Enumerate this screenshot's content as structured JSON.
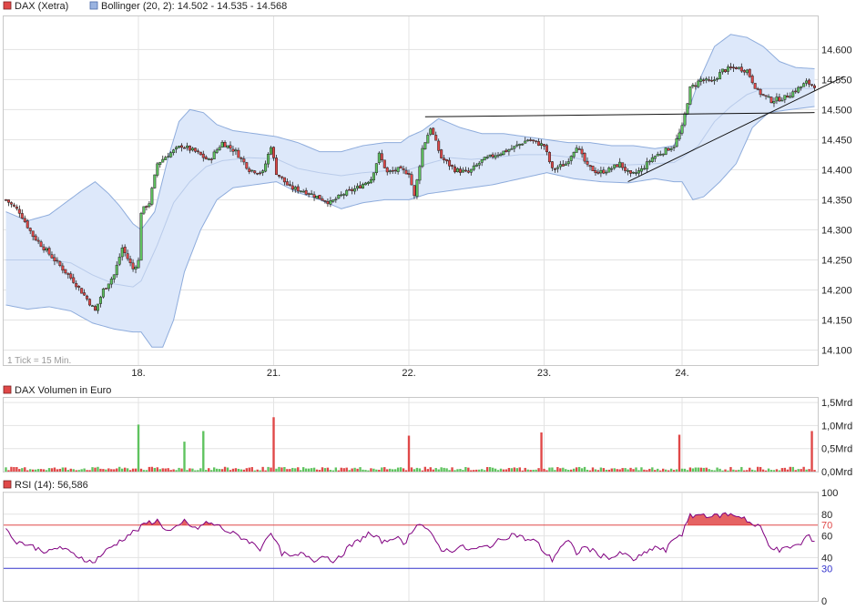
{
  "colors": {
    "up": "#5fc35f",
    "down": "#e04848",
    "band_fill": "#dde8fa",
    "band_line": "#8eacdc",
    "rsi_line": "#800080",
    "rsi_hi": "#e04848",
    "rsi_lo": "#3333cc"
  },
  "chart_data": [
    {
      "type": "candlestick",
      "legend": [
        {
          "label": "DAX (Xetra)",
          "color": "#e04848",
          "icon": "red-square-icon"
        },
        {
          "label": "Bollinger (20, 2): 14.502 - 14.535 - 14.568",
          "color": "#9ab3e0",
          "icon": "blue-square-icon"
        }
      ],
      "note": "1 Tick = 15 Min.",
      "ylim": [
        14075,
        14655
      ],
      "y_ticks": [
        "14.100",
        "14.150",
        "14.200",
        "14.250",
        "14.300",
        "14.350",
        "14.400",
        "14.450",
        "14.500",
        "14.550",
        "14.600"
      ],
      "y_tick_values": [
        14100,
        14150,
        14200,
        14250,
        14300,
        14350,
        14400,
        14450,
        14500,
        14550,
        14600
      ],
      "x_ticks": [
        "18.",
        "21.",
        "22.",
        "23.",
        "24."
      ],
      "x_tick_index": [
        49,
        99,
        149,
        199,
        250
      ],
      "n_bars": 300,
      "close_anchors": [
        [
          0,
          14350
        ],
        [
          5,
          14330
        ],
        [
          10,
          14290
        ],
        [
          15,
          14265
        ],
        [
          20,
          14240
        ],
        [
          25,
          14215
        ],
        [
          30,
          14185
        ],
        [
          33,
          14165
        ],
        [
          36,
          14200
        ],
        [
          40,
          14225
        ],
        [
          43,
          14270
        ],
        [
          47,
          14235
        ],
        [
          49,
          14248
        ],
        [
          50,
          14330
        ],
        [
          53,
          14345
        ],
        [
          56,
          14410
        ],
        [
          60,
          14425
        ],
        [
          65,
          14440
        ],
        [
          70,
          14430
        ],
        [
          75,
          14415
        ],
        [
          80,
          14445
        ],
        [
          85,
          14430
        ],
        [
          90,
          14400
        ],
        [
          95,
          14395
        ],
        [
          98,
          14440
        ],
        [
          100,
          14395
        ],
        [
          105,
          14370
        ],
        [
          110,
          14365
        ],
        [
          115,
          14355
        ],
        [
          120,
          14345
        ],
        [
          125,
          14360
        ],
        [
          130,
          14370
        ],
        [
          135,
          14385
        ],
        [
          138,
          14425
        ],
        [
          141,
          14395
        ],
        [
          145,
          14400
        ],
        [
          149,
          14395
        ],
        [
          151,
          14355
        ],
        [
          154,
          14435
        ],
        [
          157,
          14470
        ],
        [
          161,
          14420
        ],
        [
          166,
          14400
        ],
        [
          171,
          14395
        ],
        [
          176,
          14415
        ],
        [
          181,
          14425
        ],
        [
          187,
          14435
        ],
        [
          193,
          14450
        ],
        [
          199,
          14440
        ],
        [
          202,
          14400
        ],
        [
          207,
          14410
        ],
        [
          211,
          14440
        ],
        [
          215,
          14405
        ],
        [
          219,
          14395
        ],
        [
          223,
          14400
        ],
        [
          227,
          14410
        ],
        [
          231,
          14390
        ],
        [
          235,
          14400
        ],
        [
          239,
          14420
        ],
        [
          243,
          14430
        ],
        [
          247,
          14440
        ],
        [
          250,
          14470
        ],
        [
          253,
          14535
        ],
        [
          257,
          14550
        ],
        [
          261,
          14545
        ],
        [
          265,
          14565
        ],
        [
          270,
          14570
        ],
        [
          274,
          14565
        ],
        [
          278,
          14530
        ],
        [
          283,
          14515
        ],
        [
          288,
          14520
        ],
        [
          293,
          14535
        ],
        [
          296,
          14545
        ],
        [
          299,
          14540
        ]
      ],
      "bollinger_upper_anchors": [
        [
          0,
          14330
        ],
        [
          8,
          14315
        ],
        [
          16,
          14325
        ],
        [
          22,
          14345
        ],
        [
          28,
          14365
        ],
        [
          33,
          14380
        ],
        [
          38,
          14360
        ],
        [
          42,
          14340
        ],
        [
          47,
          14310
        ],
        [
          50,
          14300
        ],
        [
          55,
          14330
        ],
        [
          60,
          14420
        ],
        [
          64,
          14480
        ],
        [
          68,
          14500
        ],
        [
          73,
          14495
        ],
        [
          78,
          14475
        ],
        [
          84,
          14465
        ],
        [
          92,
          14460
        ],
        [
          100,
          14455
        ],
        [
          108,
          14445
        ],
        [
          116,
          14430
        ],
        [
          124,
          14430
        ],
        [
          132,
          14440
        ],
        [
          140,
          14445
        ],
        [
          146,
          14445
        ],
        [
          149,
          14455
        ],
        [
          154,
          14465
        ],
        [
          160,
          14485
        ],
        [
          168,
          14470
        ],
        [
          176,
          14460
        ],
        [
          184,
          14460
        ],
        [
          192,
          14455
        ],
        [
          200,
          14450
        ],
        [
          208,
          14445
        ],
        [
          216,
          14445
        ],
        [
          224,
          14440
        ],
        [
          232,
          14440
        ],
        [
          240,
          14435
        ],
        [
          247,
          14440
        ],
        [
          250,
          14470
        ],
        [
          256,
          14545
        ],
        [
          262,
          14605
        ],
        [
          268,
          14625
        ],
        [
          274,
          14620
        ],
        [
          280,
          14605
        ],
        [
          286,
          14580
        ],
        [
          292,
          14570
        ],
        [
          299,
          14568
        ]
      ],
      "bollinger_mid_anchors": [
        [
          0,
          14250
        ],
        [
          8,
          14250
        ],
        [
          16,
          14250
        ],
        [
          24,
          14245
        ],
        [
          32,
          14225
        ],
        [
          40,
          14210
        ],
        [
          47,
          14205
        ],
        [
          50,
          14215
        ],
        [
          56,
          14275
        ],
        [
          62,
          14345
        ],
        [
          68,
          14380
        ],
        [
          74,
          14405
        ],
        [
          80,
          14415
        ],
        [
          90,
          14420
        ],
        [
          100,
          14418
        ],
        [
          108,
          14402
        ],
        [
          116,
          14395
        ],
        [
          124,
          14390
        ],
        [
          132,
          14395
        ],
        [
          140,
          14398
        ],
        [
          149,
          14400
        ],
        [
          156,
          14410
        ],
        [
          164,
          14420
        ],
        [
          172,
          14417
        ],
        [
          180,
          14420
        ],
        [
          190,
          14425
        ],
        [
          200,
          14425
        ],
        [
          210,
          14420
        ],
        [
          220,
          14410
        ],
        [
          230,
          14408
        ],
        [
          240,
          14410
        ],
        [
          247,
          14412
        ],
        [
          250,
          14420
        ],
        [
          256,
          14440
        ],
        [
          262,
          14480
        ],
        [
          268,
          14505
        ],
        [
          274,
          14525
        ],
        [
          280,
          14535
        ],
        [
          290,
          14535
        ],
        [
          299,
          14535
        ]
      ],
      "bollinger_lower_anchors": [
        [
          0,
          14175
        ],
        [
          8,
          14168
        ],
        [
          16,
          14172
        ],
        [
          24,
          14165
        ],
        [
          32,
          14145
        ],
        [
          40,
          14135
        ],
        [
          47,
          14130
        ],
        [
          50,
          14130
        ],
        [
          54,
          14105
        ],
        [
          58,
          14105
        ],
        [
          62,
          14150
        ],
        [
          66,
          14230
        ],
        [
          72,
          14300
        ],
        [
          78,
          14350
        ],
        [
          84,
          14370
        ],
        [
          92,
          14375
        ],
        [
          100,
          14380
        ],
        [
          108,
          14362
        ],
        [
          116,
          14350
        ],
        [
          124,
          14335
        ],
        [
          132,
          14345
        ],
        [
          140,
          14350
        ],
        [
          149,
          14350
        ],
        [
          156,
          14360
        ],
        [
          164,
          14365
        ],
        [
          172,
          14370
        ],
        [
          180,
          14375
        ],
        [
          190,
          14385
        ],
        [
          200,
          14395
        ],
        [
          210,
          14385
        ],
        [
          220,
          14380
        ],
        [
          230,
          14378
        ],
        [
          240,
          14385
        ],
        [
          247,
          14380
        ],
        [
          250,
          14380
        ],
        [
          254,
          14350
        ],
        [
          258,
          14355
        ],
        [
          264,
          14380
        ],
        [
          270,
          14410
        ],
        [
          276,
          14470
        ],
        [
          282,
          14495
        ],
        [
          290,
          14500
        ],
        [
          299,
          14505
        ]
      ],
      "trendlines": [
        {
          "from": [
            155,
            14488
          ],
          "to": [
            299,
            14495
          ]
        },
        {
          "from": [
            230,
            14380
          ],
          "to": [
            310,
            14555
          ]
        }
      ]
    },
    {
      "type": "bar",
      "title": "DAX Volumen in Euro",
      "legend_color": "#e04848",
      "ylim": [
        0,
        1.6
      ],
      "y_ticks": [
        "0,0Mrd",
        "0,5Mrd",
        "1,0Mrd",
        "1,5Mrd"
      ],
      "y_tick_values": [
        0,
        0.5,
        1.0,
        1.5
      ],
      "base_volume": 0.08,
      "spikes": [
        {
          "i": 49,
          "v": 1.02,
          "up": true
        },
        {
          "i": 66,
          "v": 0.65,
          "up": true
        },
        {
          "i": 73,
          "v": 0.88,
          "up": true
        },
        {
          "i": 99,
          "v": 1.18,
          "up": false
        },
        {
          "i": 149,
          "v": 0.78,
          "up": false
        },
        {
          "i": 198,
          "v": 0.85,
          "up": false
        },
        {
          "i": 249,
          "v": 0.8,
          "up": false
        },
        {
          "i": 298,
          "v": 0.88,
          "up": false
        }
      ],
      "x_ticks": [
        "18.",
        "21.",
        "22.",
        "23.",
        "24."
      ]
    },
    {
      "type": "line",
      "title": "RSI (14): 56,586",
      "legend_color": "#e04848",
      "ylim": [
        0,
        100
      ],
      "y_ticks": [
        "0",
        "30",
        "40",
        "60",
        "70",
        "80",
        "100"
      ],
      "y_tick_values": [
        0,
        30,
        40,
        60,
        70,
        80,
        100
      ],
      "overbought": 70,
      "oversold": 30,
      "anchors": [
        [
          0,
          65
        ],
        [
          4,
          55
        ],
        [
          8,
          52
        ],
        [
          12,
          48
        ],
        [
          16,
          45
        ],
        [
          20,
          50
        ],
        [
          24,
          44
        ],
        [
          28,
          40
        ],
        [
          32,
          35
        ],
        [
          35,
          42
        ],
        [
          38,
          48
        ],
        [
          42,
          55
        ],
        [
          46,
          62
        ],
        [
          49,
          66
        ],
        [
          52,
          72
        ],
        [
          56,
          74
        ],
        [
          60,
          64
        ],
        [
          64,
          68
        ],
        [
          66,
          74
        ],
        [
          70,
          66
        ],
        [
          74,
          72
        ],
        [
          78,
          70
        ],
        [
          82,
          64
        ],
        [
          86,
          60
        ],
        [
          90,
          55
        ],
        [
          94,
          48
        ],
        [
          97,
          62
        ],
        [
          99,
          58
        ],
        [
          102,
          44
        ],
        [
          106,
          40
        ],
        [
          110,
          44
        ],
        [
          114,
          38
        ],
        [
          118,
          42
        ],
        [
          122,
          36
        ],
        [
          126,
          48
        ],
        [
          130,
          55
        ],
        [
          134,
          62
        ],
        [
          137,
          58
        ],
        [
          140,
          54
        ],
        [
          144,
          60
        ],
        [
          147,
          52
        ],
        [
          149,
          60
        ],
        [
          152,
          72
        ],
        [
          155,
          68
        ],
        [
          158,
          58
        ],
        [
          161,
          48
        ],
        [
          164,
          46
        ],
        [
          168,
          50
        ],
        [
          172,
          47
        ],
        [
          176,
          49
        ],
        [
          180,
          52
        ],
        [
          184,
          58
        ],
        [
          188,
          62
        ],
        [
          192,
          57
        ],
        [
          196,
          55
        ],
        [
          199,
          45
        ],
        [
          202,
          38
        ],
        [
          205,
          50
        ],
        [
          208,
          55
        ],
        [
          211,
          44
        ],
        [
          214,
          50
        ],
        [
          217,
          46
        ],
        [
          220,
          42
        ],
        [
          224,
          40
        ],
        [
          228,
          44
        ],
        [
          232,
          38
        ],
        [
          236,
          43
        ],
        [
          240,
          50
        ],
        [
          244,
          46
        ],
        [
          247,
          58
        ],
        [
          250,
          62
        ],
        [
          253,
          78
        ],
        [
          257,
          80
        ],
        [
          262,
          78
        ],
        [
          266,
          80
        ],
        [
          270,
          79
        ],
        [
          273,
          77
        ],
        [
          276,
          70
        ],
        [
          279,
          68
        ],
        [
          282,
          52
        ],
        [
          286,
          46
        ],
        [
          290,
          50
        ],
        [
          294,
          52
        ],
        [
          296,
          60
        ],
        [
          299,
          56
        ]
      ],
      "x_ticks": [
        "18.",
        "21.",
        "22.",
        "23.",
        "24."
      ]
    }
  ]
}
